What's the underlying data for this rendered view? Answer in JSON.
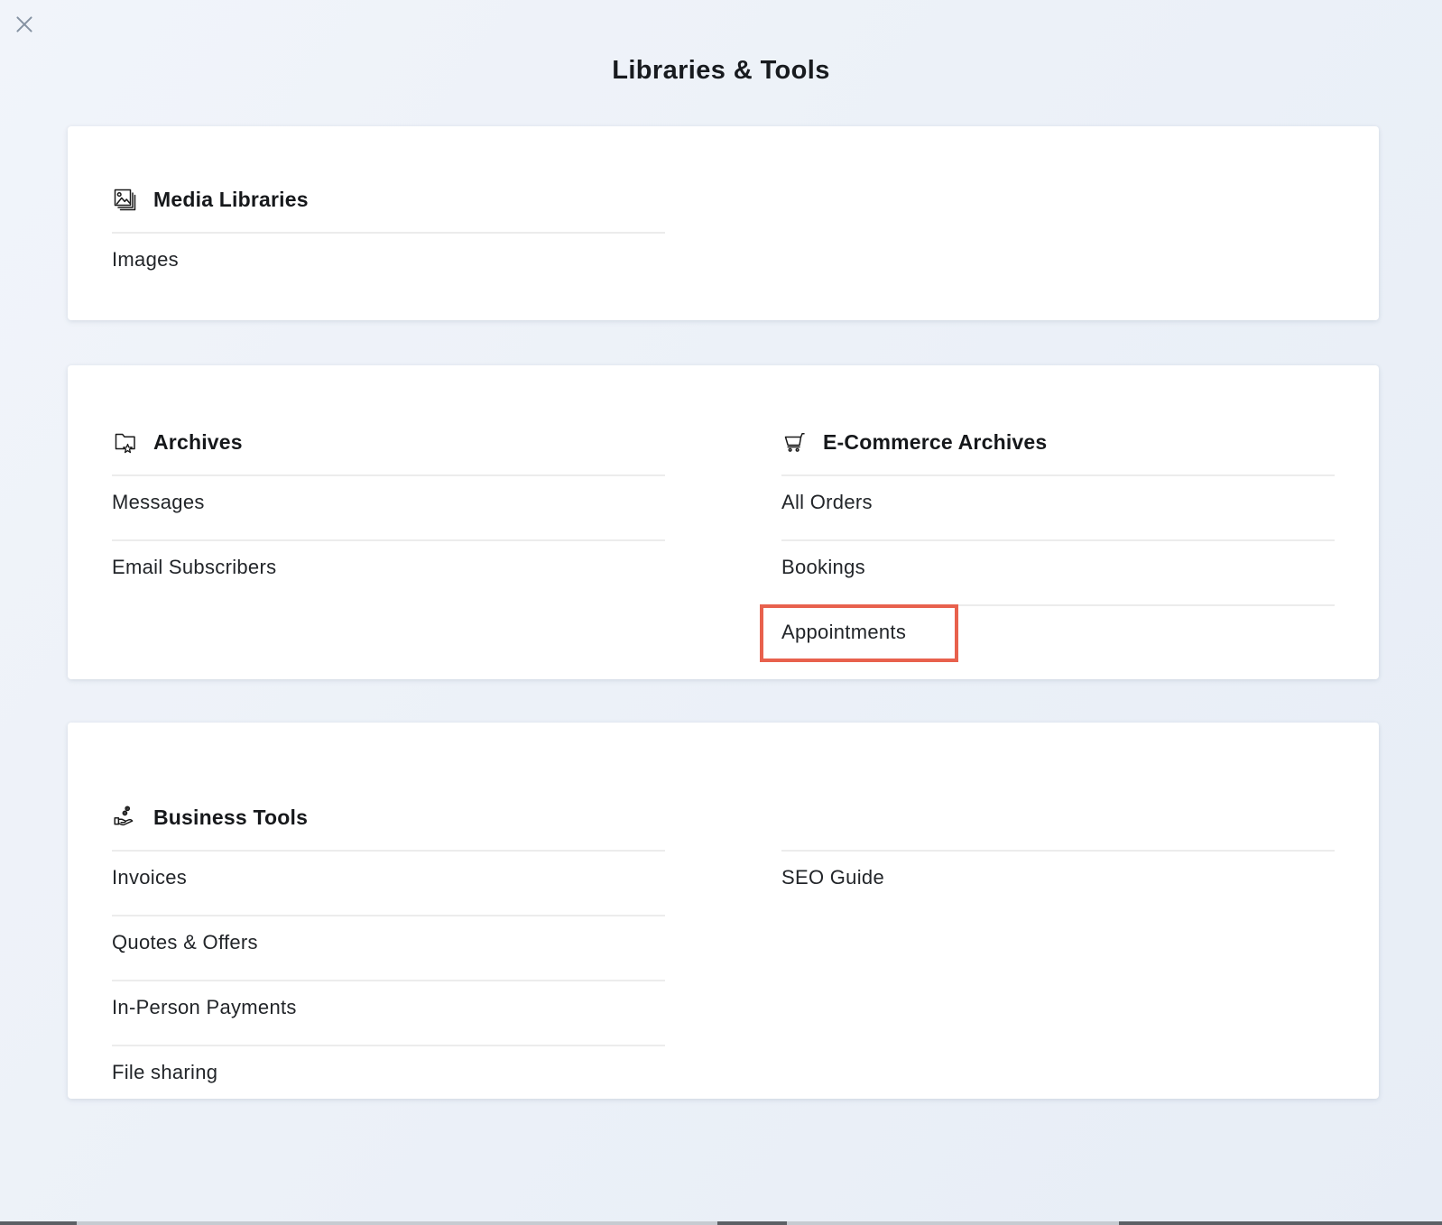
{
  "page": {
    "title": "Libraries & Tools"
  },
  "colors": {
    "background": "#edf1f8",
    "card": "#ffffff",
    "divider": "#ececec",
    "text": "#202327",
    "highlight_accent": "#e8614d",
    "close_icon": "#8592a2"
  },
  "cards": [
    {
      "name": "media-libraries",
      "sections": [
        {
          "icon": "photo-stack-icon",
          "title": "Media Libraries",
          "items": [
            "Images"
          ]
        }
      ]
    },
    {
      "name": "archives",
      "sections": [
        {
          "icon": "folder-star-icon",
          "title": "Archives",
          "items": [
            "Messages",
            "Email Subscribers"
          ]
        },
        {
          "icon": "cart-icon",
          "title": "E-Commerce Archives",
          "items": [
            "All Orders",
            "Bookings",
            "Appointments"
          ],
          "highlighted_item": "Appointments"
        }
      ]
    },
    {
      "name": "business-tools",
      "sections": [
        {
          "icon": "hand-coins-icon",
          "title": "Business Tools",
          "items": [
            "Invoices",
            "Quotes & Offers",
            "In-Person Payments",
            "File sharing"
          ]
        },
        {
          "icon": null,
          "title": null,
          "items": [
            "SEO Guide"
          ]
        }
      ]
    }
  ]
}
